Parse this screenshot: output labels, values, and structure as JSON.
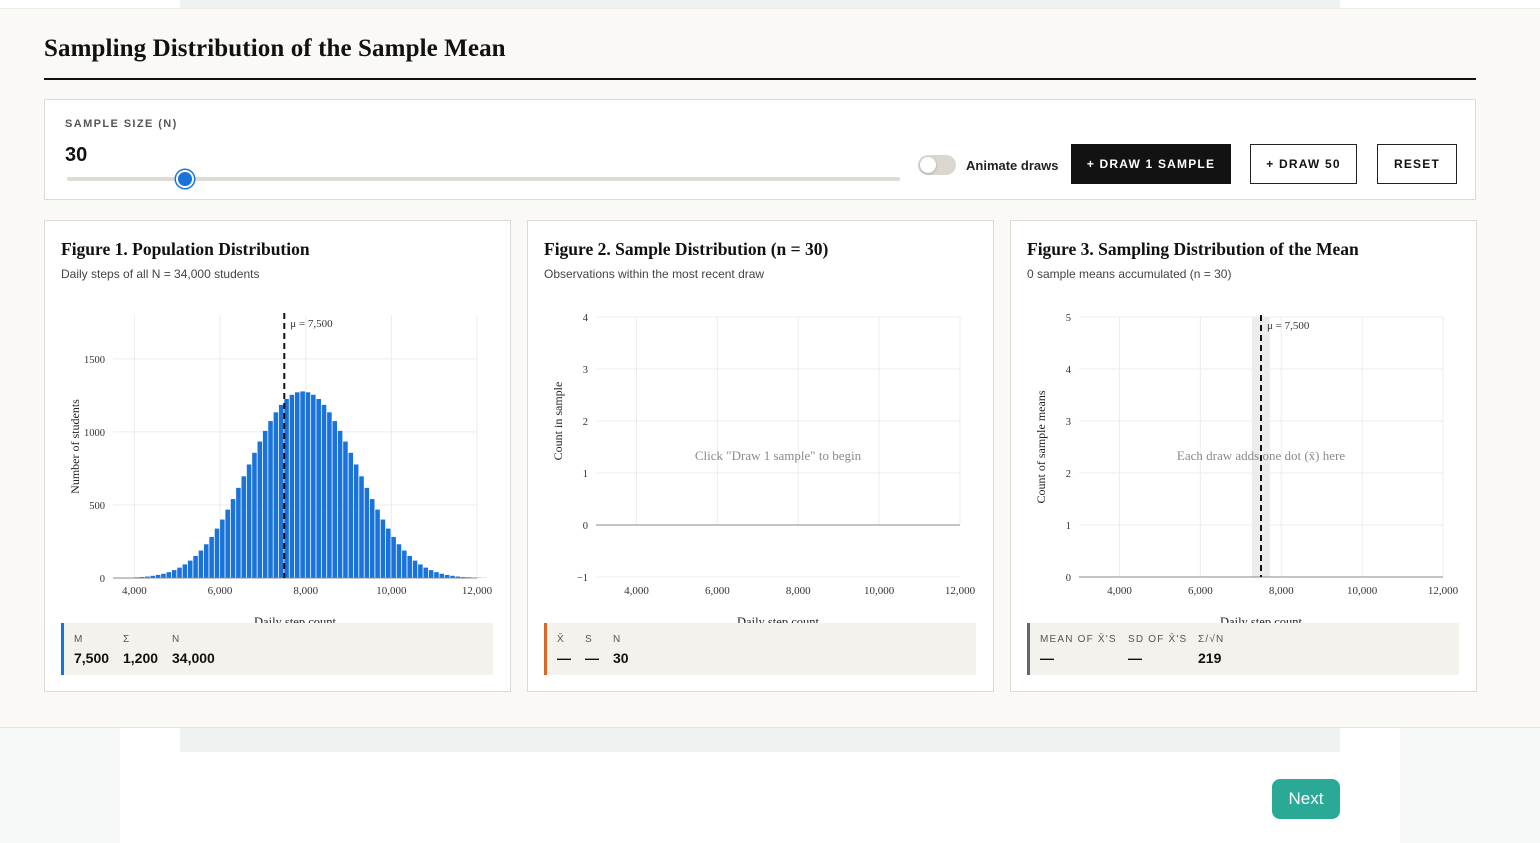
{
  "page": {
    "title": "Sampling Distribution of the Sample Mean"
  },
  "controls": {
    "sample_size_label": "SAMPLE SIZE (N)",
    "sample_size_value": "30",
    "slider": {
      "value": 30,
      "min": 2,
      "max": 200
    },
    "animate_label": "Animate draws",
    "animate_on": false,
    "draw_one_label": "+ DRAW 1 SAMPLE",
    "draw_fifty_label": "+ DRAW 50",
    "reset_label": "RESET"
  },
  "figures": [
    {
      "title": "Figure 1. Population Distribution",
      "subtitle": "Daily steps of all N = 34,000 students",
      "accent": "#1a73d9",
      "stats": [
        {
          "label": "M",
          "value": "7,500"
        },
        {
          "label": "Σ",
          "value": "1,200"
        },
        {
          "label": "N",
          "value": "34,000"
        }
      ]
    },
    {
      "title": "Figure 2. Sample Distribution (n = 30)",
      "subtitle": "Observations within the most recent draw",
      "accent": "#d9662a",
      "stats": [
        {
          "label": "X̄",
          "value": "—"
        },
        {
          "label": "S",
          "value": "—"
        },
        {
          "label": "N",
          "value": "30"
        }
      ]
    },
    {
      "title": "Figure 3. Sampling Distribution of the Mean",
      "subtitle": "0 sample means accumulated (n = 30)",
      "accent": "#666666",
      "stats": [
        {
          "label": "MEAN OF X̄'S",
          "value": "—"
        },
        {
          "label": "SD OF X̄'S",
          "value": "—"
        },
        {
          "label": "Σ/√N",
          "value": "219"
        }
      ]
    }
  ],
  "chart_data": [
    {
      "type": "bar",
      "xlabel": "Daily step count",
      "ylabel": "Number of students",
      "xlim": [
        3500,
        12000
      ],
      "ylim": [
        0,
        1800
      ],
      "xticks": [
        4000,
        6000,
        8000,
        10000,
        12000
      ],
      "xtick_labels": [
        "4,000",
        "6,000",
        "8,000",
        "10,000",
        "12,000"
      ],
      "yticks": [
        0,
        500,
        1000,
        1500
      ],
      "ytick_labels": [
        "0",
        "500",
        "1000",
        "1500"
      ],
      "mean_line": {
        "x": 7500,
        "label": "μ = 7,500"
      },
      "bin_width": 125,
      "bins_start": 3500,
      "values": [
        1,
        1,
        2,
        3,
        5,
        7,
        10,
        15,
        21,
        29,
        40,
        54,
        71,
        93,
        119,
        151,
        188,
        231,
        281,
        338,
        400,
        468,
        540,
        617,
        696,
        777,
        857,
        934,
        1007,
        1074,
        1134,
        1185,
        1225,
        1254,
        1271,
        1277,
        1271,
        1254,
        1225,
        1185,
        1134,
        1074,
        1007,
        934,
        857,
        777,
        696,
        617,
        540,
        468,
        400,
        338,
        281,
        231,
        188,
        151,
        119,
        93,
        71,
        54,
        40,
        29,
        21,
        15,
        10,
        7,
        5,
        3,
        2,
        1
      ],
      "grid": true
    },
    {
      "type": "bar",
      "xlabel": "Daily step count",
      "ylabel": "Count in sample",
      "xlim": [
        3000,
        12000
      ],
      "ylim": [
        -1,
        4
      ],
      "xticks": [
        4000,
        6000,
        8000,
        10000,
        12000
      ],
      "xtick_labels": [
        "4,000",
        "6,000",
        "8,000",
        "10,000",
        "12,000"
      ],
      "yticks": [
        -1,
        0,
        1,
        2,
        3,
        4
      ],
      "ytick_labels": [
        "−1",
        "0",
        "1",
        "2",
        "3",
        "4"
      ],
      "values": [],
      "placeholder": "Click \"Draw 1 sample\" to begin",
      "grid": true
    },
    {
      "type": "scatter",
      "xlabel": "Daily step count",
      "ylabel": "Count of sample means",
      "xlim": [
        3000,
        12000
      ],
      "ylim": [
        0,
        5
      ],
      "xticks": [
        4000,
        6000,
        8000,
        10000,
        12000
      ],
      "xtick_labels": [
        "4,000",
        "6,000",
        "8,000",
        "10,000",
        "12,000"
      ],
      "yticks": [
        0,
        1,
        2,
        3,
        4,
        5
      ],
      "ytick_labels": [
        "0",
        "1",
        "2",
        "3",
        "4",
        "5"
      ],
      "mean_line": {
        "x": 7500,
        "label": "μ = 7,500",
        "band_halfwidth": 219
      },
      "values": [],
      "placeholder": "Each draw adds one dot (x̄) here",
      "grid": true
    }
  ],
  "footer": {
    "next_label": "Next"
  }
}
